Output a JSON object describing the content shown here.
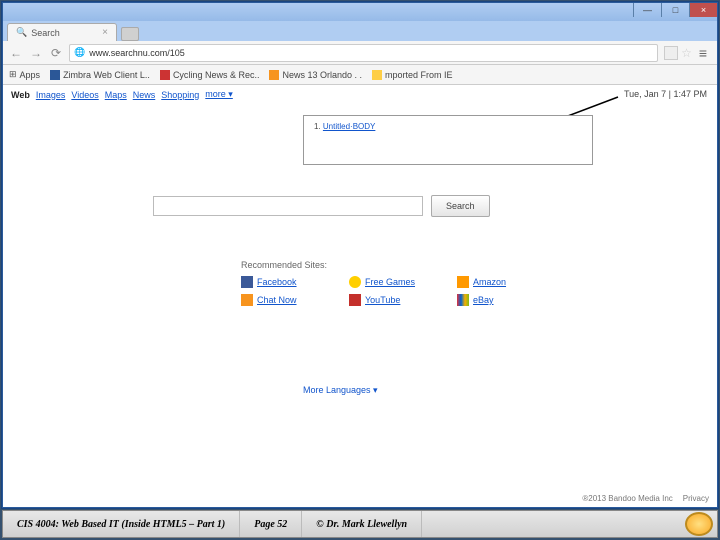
{
  "window": {
    "min": "—",
    "max": "□",
    "close": "×"
  },
  "tab": {
    "title": "Search",
    "x": "×"
  },
  "toolbar": {
    "back": "←",
    "fwd": "→",
    "reload": "⟳",
    "url": "www.searchnu.com/105",
    "star": "☆",
    "menu": "≡",
    "apps": "Apps"
  },
  "bookmarks": [
    {
      "label": "Zimbra Web Client L.."
    },
    {
      "label": "Cycling News & Rec.."
    },
    {
      "label": "News 13 Orlando . ."
    },
    {
      "label": "mported From IE"
    }
  ],
  "searchnav": [
    "Web",
    "Images",
    "Videos",
    "Maps",
    "News",
    "Shopping",
    "more ▾"
  ],
  "timestamp": "Tue, Jan 7 | 1:47 PM",
  "result": {
    "prefix": "1. ",
    "link": "Untitled·BODY"
  },
  "search": {
    "btn": "Search",
    "placeholder": ""
  },
  "rec_title": "Recommended Sites:",
  "sites": [
    {
      "icon": "fb",
      "label": "Facebook"
    },
    {
      "icon": "sm",
      "label": "Free Games"
    },
    {
      "icon": "am",
      "label": "Amazon"
    },
    {
      "icon": "tw",
      "label": "Chat Now"
    },
    {
      "icon": "yt",
      "label": "YouTube"
    },
    {
      "icon": "eb",
      "label": "eBay"
    }
  ],
  "more_lang": "More Languages ▾",
  "footer_right": {
    "copy": "®2013 Bandoo Media Inc",
    "privacy": "Privacy"
  },
  "slide_footer": {
    "course": "CIS 4004: Web Based IT (Inside HTML5 – Part 1)",
    "page": "Page 52",
    "author": "© Dr. Mark Llewellyn"
  }
}
